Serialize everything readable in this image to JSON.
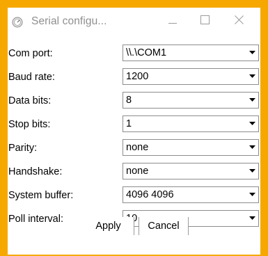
{
  "window": {
    "title": "Serial configu...",
    "icons": {
      "app": "dial-icon",
      "minimize": "minimize-icon",
      "maximize": "maximize-icon",
      "close": "close-icon"
    }
  },
  "fields": [
    {
      "label": "Com port:",
      "value": "\\\\.\\COM1"
    },
    {
      "label": "Baud rate:",
      "value": "1200"
    },
    {
      "label": "Data bits:",
      "value": "8"
    },
    {
      "label": "Stop bits:",
      "value": "1"
    },
    {
      "label": "Parity:",
      "value": "none"
    },
    {
      "label": "Handshake:",
      "value": "none"
    },
    {
      "label": "System buffer:",
      "value": "4096 4096"
    },
    {
      "label": "Poll interval:",
      "value": "10"
    }
  ],
  "buttons": {
    "apply": "Apply",
    "cancel": "Cancel"
  },
  "colors": {
    "frame": "#f6a800",
    "background": "#ffffff",
    "title_text": "#8f8f8f"
  }
}
